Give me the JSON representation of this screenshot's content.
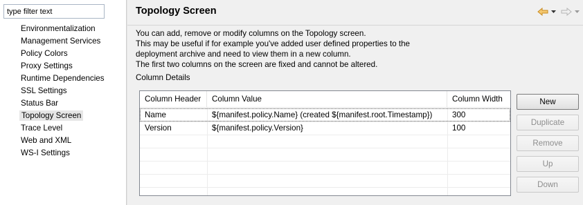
{
  "filter": {
    "placeholder": "type filter text",
    "value": "type filter text"
  },
  "tree": {
    "items": [
      "Environmentalization",
      "Management Services",
      "Policy Colors",
      "Proxy Settings",
      "Runtime Dependencies",
      "SSL Settings",
      "Status Bar",
      "Topology Screen",
      "Trace Level",
      "Web and XML",
      "WS-I Settings"
    ],
    "selected": "Topology Screen"
  },
  "page": {
    "title": "Topology Screen",
    "description": [
      "You can add, remove or modify columns on the Topology screen.",
      "This may be useful if for example you've added user defined properties to the",
      "deployment archive and need to view them in a new column.",
      "The first two columns on the screen are fixed and cannot be altered."
    ],
    "details_label": "Column Details"
  },
  "nav": {
    "back_icon": "back-arrow-icon",
    "forward_icon": "forward-arrow-icon",
    "accent": "#e8a33b"
  },
  "table": {
    "headers": [
      "Column Header",
      "Column Value",
      "Column Width"
    ],
    "rows": [
      [
        "Name",
        "${manifest.policy.Name} (created ${manifest.root.Timestamp})",
        "300"
      ],
      [
        "Version",
        "${manifest.policy.Version}",
        "100"
      ]
    ]
  },
  "buttons": {
    "new": "New",
    "duplicate": "Duplicate",
    "remove": "Remove",
    "up": "Up",
    "down": "Down"
  }
}
